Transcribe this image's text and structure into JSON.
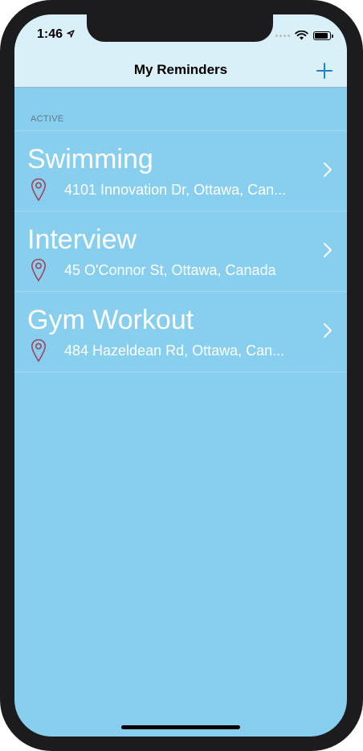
{
  "status_bar": {
    "time": "1:46",
    "icons": [
      "location-arrow-icon",
      "cellular-signal-icon",
      "wifi-icon",
      "battery-icon"
    ]
  },
  "nav": {
    "title": "My Reminders",
    "add_icon": "plus-icon"
  },
  "colors": {
    "background": "#87ceef",
    "nav_background": "#d9f0f8",
    "accent": "#1e7fd6",
    "pin": "#a0455a",
    "text_light": "#ffffff"
  },
  "section": {
    "header": "ACTIVE"
  },
  "reminders": [
    {
      "title": "Swimming",
      "address": "4101 Innovation Dr, Ottawa, Can..."
    },
    {
      "title": "Interview",
      "address": "45 O'Connor St, Ottawa, Canada"
    },
    {
      "title": "Gym Workout",
      "address": "484 Hazeldean Rd, Ottawa, Can..."
    }
  ]
}
